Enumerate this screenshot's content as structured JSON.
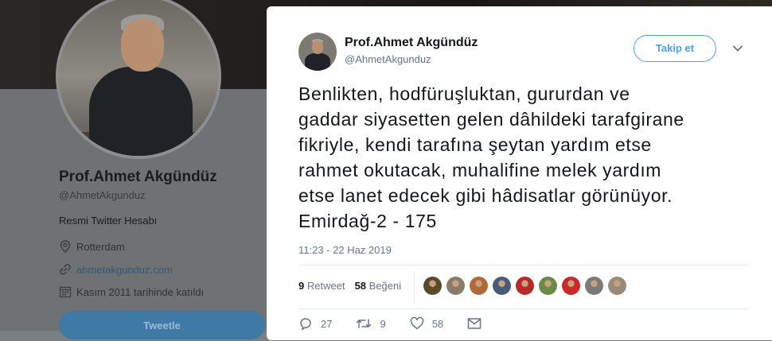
{
  "profile": {
    "name": "Prof.Ahmet Akgündüz",
    "handle": "@AhmetAkgunduz",
    "bio": "Resmi Twitter Hesabı",
    "location": "Rotterdam",
    "website": "ahmetakgunduz.com",
    "joined": "Kasım 2011 tarihinde katıldı",
    "tweet_button": "Tweetle"
  },
  "tweet": {
    "author_name": "Prof.Ahmet Akgündüz",
    "author_handle": "@AhmetAkgunduz",
    "follow_label": "Takip et",
    "text": "Benlikten, hodfüruşluktan, gururdan ve\ngaddar siyasetten gelen dâhildeki tarafgirane\nfikriyle, kendi tarafına şeytan yardım etse\nrahmet okutacak, muhalifine melek yardım\netse lanet edecek gibi hâdisatlar görünüyor.\nEmirdağ-2 - 175",
    "timestamp": "11:23 - 22 Haz 2019",
    "retweet_count": "9",
    "retweet_label": "Retweet",
    "like_count": "58",
    "like_label": "Beğeni",
    "reply_action_count": "27",
    "retweet_action_count": "9",
    "like_action_count": "58"
  },
  "likers": [
    {
      "name": "liker-1",
      "color": "#5a4a2a"
    },
    {
      "name": "liker-2",
      "color": "#8a7a6a"
    },
    {
      "name": "liker-3",
      "color": "#b06a3a"
    },
    {
      "name": "liker-4",
      "color": "#4a5a7a"
    },
    {
      "name": "liker-5",
      "color": "#b82a2a"
    },
    {
      "name": "liker-6",
      "color": "#6a8a4a"
    },
    {
      "name": "liker-7",
      "color": "#c82a2a"
    },
    {
      "name": "liker-8",
      "color": "#7a7a7a"
    },
    {
      "name": "liker-9",
      "color": "#9a8a7a"
    }
  ],
  "colors": {
    "accent": "#1da1f2",
    "follow_border": "#4aa1eb",
    "secondary_text": "#657786"
  }
}
